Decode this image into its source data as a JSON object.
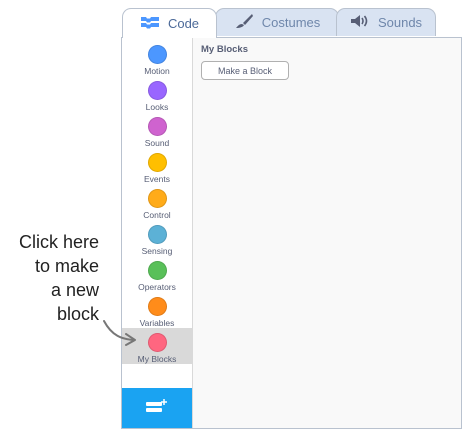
{
  "tabs": [
    {
      "label": "Code",
      "icon": "code-blocks-icon",
      "active": true
    },
    {
      "label": "Costumes",
      "icon": "brush-icon",
      "active": false
    },
    {
      "label": "Sounds",
      "icon": "speaker-icon",
      "active": false
    }
  ],
  "categories": [
    {
      "label": "Motion",
      "color": "#4C97FF"
    },
    {
      "label": "Looks",
      "color": "#9966FF"
    },
    {
      "label": "Sound",
      "color": "#CF63CF"
    },
    {
      "label": "Events",
      "color": "#FFBF00"
    },
    {
      "label": "Control",
      "color": "#FFAB19"
    },
    {
      "label": "Sensing",
      "color": "#5CB1D6"
    },
    {
      "label": "Operators",
      "color": "#59C059"
    },
    {
      "label": "Variables",
      "color": "#FF8C1A"
    },
    {
      "label": "My Blocks",
      "color": "#FF6680",
      "selected": true
    }
  ],
  "palette": {
    "title": "My Blocks",
    "make_block_label": "Make a Block"
  },
  "annotation": {
    "lines": [
      "Click here",
      "to make",
      "a new",
      "block"
    ]
  },
  "colors": {
    "extension_button": "#1aa3f2",
    "tab_active_text": "#4c6a99",
    "tab_inactive_bg": "#d9e3f2"
  },
  "extension_button": {
    "icon": "add-extension-icon"
  }
}
